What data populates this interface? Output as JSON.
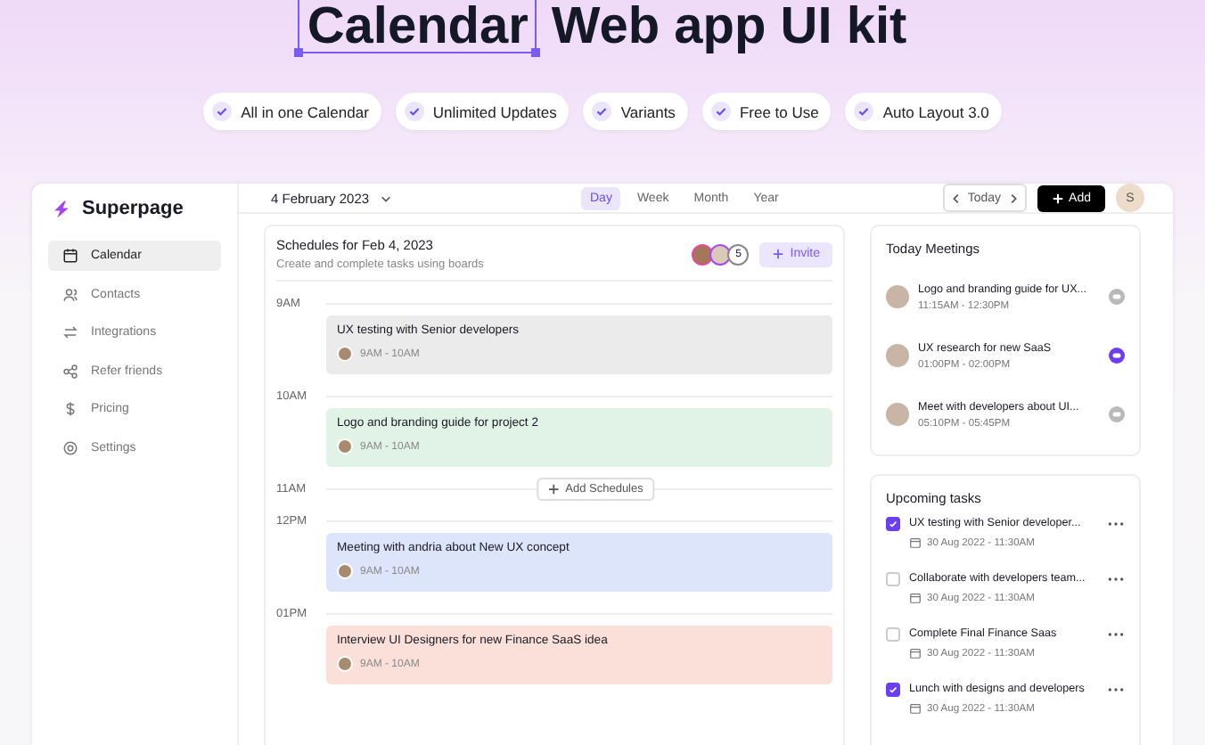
{
  "hero": {
    "highlight": "Calendar",
    "rest": "Web app UI kit"
  },
  "features": [
    "All in one Calendar",
    "Unlimited Updates",
    "Variants",
    "Free to Use",
    "Auto Layout 3.0"
  ],
  "sidebar": {
    "brand": "Superpage",
    "items": [
      {
        "label": "Calendar",
        "selected": true
      },
      {
        "label": "Contacts",
        "selected": false
      },
      {
        "label": "Integrations",
        "selected": false
      },
      {
        "label": "Refer friends",
        "selected": false
      },
      {
        "label": "Pricing",
        "selected": false
      },
      {
        "label": "Settings",
        "selected": false
      }
    ]
  },
  "header": {
    "date": "4 February 2023",
    "tabs": [
      {
        "label": "Day",
        "selected": true
      },
      {
        "label": "Week",
        "selected": false
      },
      {
        "label": "Month",
        "selected": false
      },
      {
        "label": "Year",
        "selected": false
      }
    ],
    "today": "Today",
    "add": "Add",
    "avatar": "S"
  },
  "schedule": {
    "title": "Schedules for Feb 4, 2023",
    "subtitle": "Create and complete tasks using boards",
    "member_count": "5",
    "invite": "Invite",
    "slots": [
      {
        "time": "9AM",
        "event": {
          "title": "UX testing with Senior developers",
          "time": "9AM - 10AM",
          "color": "#ebebeb"
        }
      },
      {
        "time": "10AM",
        "event": {
          "title": "Logo and branding guide for project 2",
          "time": "9AM - 10AM",
          "color": "#e0f3e6"
        }
      },
      {
        "time": "11AM",
        "action": "Add Schedules"
      },
      {
        "time": "12PM",
        "event": {
          "title": "Meeting with andria about New UX concept",
          "time": "9AM - 10AM",
          "color": "#dde5fb"
        }
      },
      {
        "time": "01PM",
        "event": {
          "title": "Interview UI Designers for new Finance SaaS idea",
          "time": "9AM - 10AM",
          "color": "#fbe0d9"
        }
      }
    ]
  },
  "meetings": {
    "title": "Today Meetings",
    "items": [
      {
        "title": "Logo and branding guide for UX...",
        "time": "11:15AM - 12:30PM",
        "active": false
      },
      {
        "title": "UX research for new SaaS",
        "time": "01:00PM - 02:00PM",
        "active": true
      },
      {
        "title": "Meet with developers about UI...",
        "time": "05:10PM - 05:45PM",
        "active": false
      }
    ]
  },
  "tasks": {
    "title": "Upcoming tasks",
    "items": [
      {
        "title": "UX testing with Senior developer...",
        "date": "30 Aug 2022 - 11:30AM",
        "checked": true
      },
      {
        "title": "Collaborate with developers team...",
        "date": "30 Aug 2022 - 11:30AM",
        "checked": false
      },
      {
        "title": "Complete Final Finance Saas",
        "date": "30 Aug 2022 - 11:30AM",
        "checked": false
      },
      {
        "title": "Lunch with designs and developers",
        "date": "30 Aug 2022 - 11:30AM",
        "checked": true
      }
    ]
  }
}
